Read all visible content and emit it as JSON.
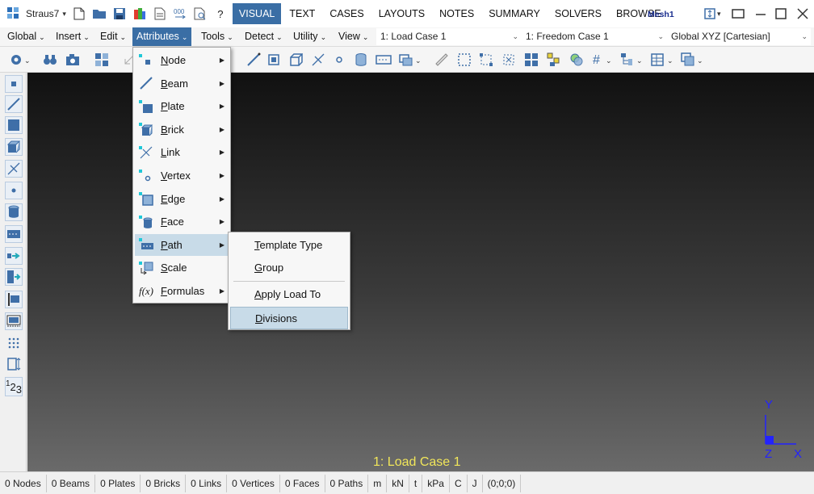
{
  "titlebar": {
    "app_name": "Straus7",
    "tabs": [
      "VISUAL",
      "TEXT",
      "CASES",
      "LAYOUTS",
      "NOTES",
      "SUMMARY",
      "SOLVERS",
      "BROWSE"
    ],
    "active_tab": "VISUAL",
    "model_name": "Mesh1",
    "help_label": "?"
  },
  "menubar": {
    "items": [
      "Global",
      "Insert",
      "Edit",
      "Attributes",
      "Tools",
      "Detect",
      "Utility",
      "View"
    ],
    "active": "Attributes",
    "load_case": "1: Load Case 1",
    "freedom_case": "1: Freedom Case 1",
    "coord_system": "Global XYZ [Cartesian]"
  },
  "attributes_menu": {
    "items": [
      {
        "label": "Node",
        "accel": "N",
        "rest": "ode",
        "has_sub": true,
        "icon": "node-icon"
      },
      {
        "label": "Beam",
        "accel": "B",
        "rest": "eam",
        "has_sub": true,
        "icon": "beam-icon"
      },
      {
        "label": "Plate",
        "accel": "P",
        "rest": "late",
        "has_sub": true,
        "icon": "plate-icon"
      },
      {
        "label": "Brick",
        "accel": "B",
        "rest": "rick",
        "has_sub": true,
        "icon": "brick-icon"
      },
      {
        "label": "Link",
        "accel": "L",
        "rest": "ink",
        "has_sub": true,
        "icon": "link-icon"
      },
      {
        "label": "Vertex",
        "accel": "V",
        "rest": "ertex",
        "has_sub": true,
        "icon": "vertex-icon"
      },
      {
        "label": "Edge",
        "accel": "E",
        "rest": "dge",
        "has_sub": true,
        "icon": "edge-icon"
      },
      {
        "label": "Face",
        "accel": "F",
        "rest": "ace",
        "has_sub": true,
        "icon": "face-icon"
      },
      {
        "label": "Path",
        "accel": "P",
        "rest": "ath",
        "has_sub": true,
        "icon": "path-icon"
      },
      {
        "label": "Scale",
        "accel": "S",
        "rest": "cale",
        "has_sub": false,
        "icon": "scale-icon"
      },
      {
        "label": "Formulas",
        "accel": "F",
        "rest": "ormulas",
        "has_sub": true,
        "icon": "formula-icon"
      }
    ],
    "highlighted": "Path",
    "formula_icon_text": "f(x)"
  },
  "path_submenu": {
    "items": [
      {
        "accel": "T",
        "rest": "emplate Type"
      },
      {
        "accel": "G",
        "rest": "roup"
      },
      {
        "accel": "A",
        "rest": "pply Load To"
      },
      {
        "accel": "D",
        "rest": "ivisions"
      }
    ],
    "highlighted": "Divisions"
  },
  "viewport": {
    "load_case_label": "1: Load Case 1",
    "axis_labels": {
      "x": "X",
      "y": "Y",
      "z": "Z"
    }
  },
  "left_toolbar": {
    "numbering_label_1": "1",
    "numbering_label_2": "2",
    "numbering_label_3": "3"
  },
  "statusbar": {
    "items": [
      "0 Nodes",
      "0 Beams",
      "0 Plates",
      "0 Bricks",
      "0 Links",
      "0 Vertices",
      "0 Faces",
      "0 Paths",
      "m",
      "kN",
      "t",
      "kPa",
      "C",
      "J",
      "(0;0;0)"
    ]
  },
  "colors": {
    "accent": "#3a6ea5",
    "menu_highlight": "#c8dbe8",
    "load_case_text": "#f1e65a",
    "axis": "#2323ff",
    "icon_blue": "#3f6fa8",
    "icon_cyan": "#1fc8d8"
  }
}
